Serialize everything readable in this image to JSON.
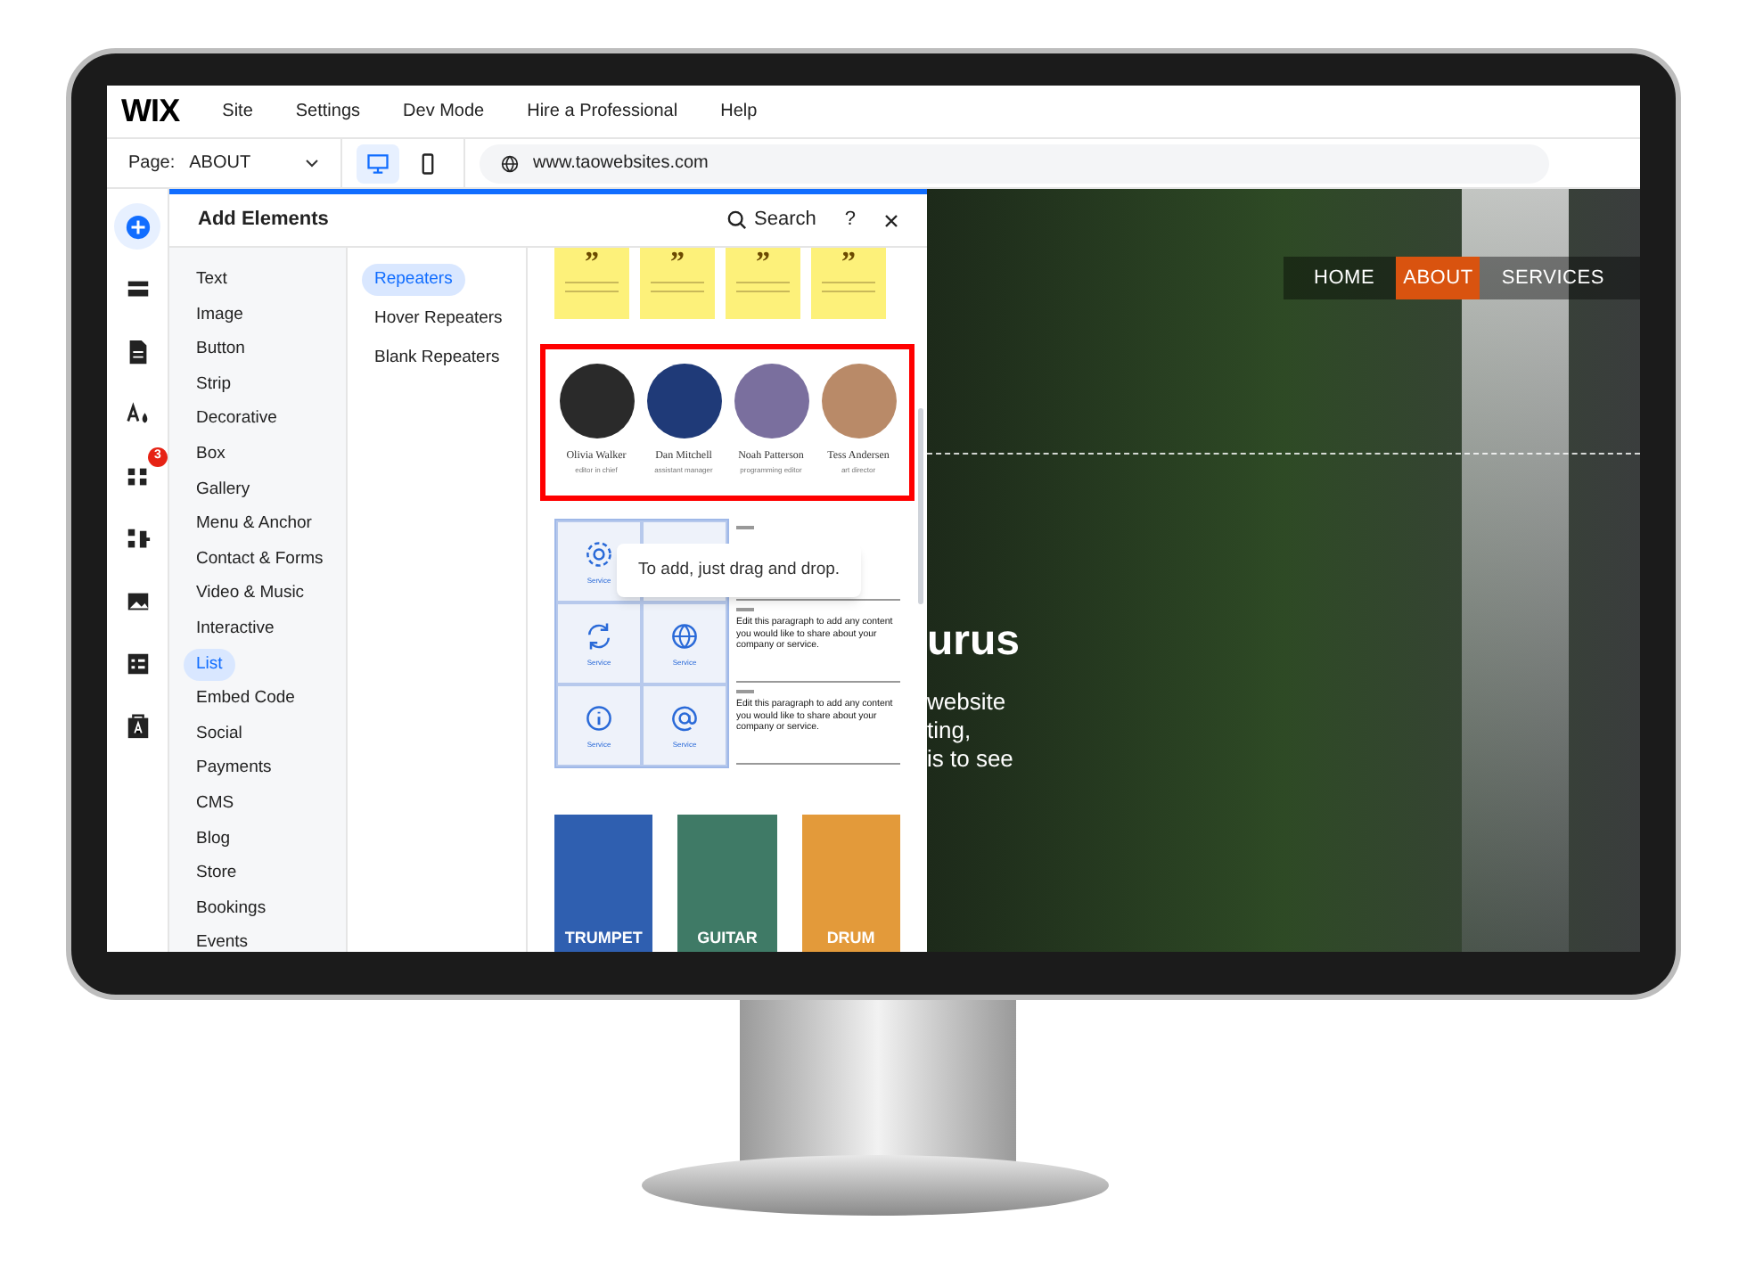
{
  "menu_bar": {
    "logo": "WIX",
    "items": [
      "Site",
      "Settings",
      "Dev Mode",
      "Hire a Professional",
      "Help"
    ]
  },
  "toolbar": {
    "page_label": "Page:",
    "page": "ABOUT",
    "devices": [
      {
        "kind": "desktop",
        "selected": true
      },
      {
        "kind": "mobile",
        "selected": false
      }
    ],
    "url": "www.taowebsites.com"
  },
  "rail": [
    {
      "kind": "add",
      "selected": true
    },
    {
      "kind": "sections",
      "selected": false
    },
    {
      "kind": "pages",
      "selected": false
    },
    {
      "kind": "design",
      "selected": false
    },
    {
      "kind": "apps",
      "selected": false,
      "badge": "3"
    },
    {
      "kind": "business",
      "selected": false
    },
    {
      "kind": "media",
      "selected": false
    },
    {
      "kind": "cms",
      "selected": false
    },
    {
      "kind": "portfolio",
      "selected": false
    }
  ],
  "panel": {
    "title": "Add Elements",
    "search": "Search",
    "help": "?",
    "categories": [
      {
        "label": "Text",
        "selected": false
      },
      {
        "label": "Image",
        "selected": false
      },
      {
        "label": "Button",
        "selected": false
      },
      {
        "label": "Strip",
        "selected": false
      },
      {
        "label": "Decorative",
        "selected": false
      },
      {
        "label": "Box",
        "selected": false
      },
      {
        "label": "Gallery",
        "selected": false
      },
      {
        "label": "Menu & Anchor",
        "selected": false
      },
      {
        "label": "Contact & Forms",
        "selected": false
      },
      {
        "label": "Video & Music",
        "selected": false
      },
      {
        "label": "Interactive",
        "selected": false
      },
      {
        "label": "List",
        "selected": true
      },
      {
        "label": "Embed Code",
        "selected": false
      },
      {
        "label": "Social",
        "selected": false
      },
      {
        "label": "Payments",
        "selected": false
      },
      {
        "label": "CMS",
        "selected": false
      },
      {
        "label": "Blog",
        "selected": false
      },
      {
        "label": "Store",
        "selected": false
      },
      {
        "label": "Bookings",
        "selected": false
      },
      {
        "label": "Events",
        "selected": false
      }
    ],
    "subcategories": [
      {
        "label": "Repeaters",
        "selected": true
      },
      {
        "label": "Hover Repeaters",
        "selected": false
      },
      {
        "label": "Blank Repeaters",
        "selected": false
      }
    ],
    "testimonials": [
      "”",
      "”",
      "”",
      "”"
    ],
    "team": [
      {
        "name": "Olivia Walker",
        "role": "editor in chief",
        "color": "#2a2a2a"
      },
      {
        "name": "Dan Mitchell",
        "role": "assistant manager",
        "color": "#1f3a78"
      },
      {
        "name": "Noah Patterson",
        "role": "programming editor",
        "color": "#7a6f9e"
      },
      {
        "name": "Tess Andersen",
        "role": "art director",
        "color": "#b98a68"
      }
    ],
    "services": [
      {
        "kind": "gear",
        "label": "Service"
      },
      {
        "kind": "blank"
      },
      {
        "kind": "refresh",
        "label": "Service"
      },
      {
        "kind": "globe",
        "label": "Service"
      },
      {
        "kind": "info",
        "label": "Service"
      },
      {
        "kind": "at",
        "label": "Service"
      }
    ],
    "list_rows": [
      {
        "kind": "covered"
      },
      {
        "kind": "paragraph",
        "text": "Edit this paragraph to add any content you would like to share about your company or service."
      },
      {
        "kind": "paragraph",
        "text": "Edit this paragraph to add any content you would like to share about your company or service."
      }
    ],
    "tooltip": "To add, just drag and drop.",
    "instruments": [
      {
        "label": "TRUMPET",
        "color": "#2f5fb0"
      },
      {
        "label": "GUITAR",
        "color": "#3f7a66"
      },
      {
        "label": "DRUM",
        "color": "#e39a3a"
      }
    ]
  },
  "site": {
    "nav": [
      {
        "label": "HOME",
        "selected": false
      },
      {
        "label": "ABOUT",
        "selected": true
      },
      {
        "label": "SERVICES",
        "selected": false
      }
    ],
    "heading": "urus",
    "lines": [
      "website",
      "ting,",
      "is to see"
    ]
  }
}
